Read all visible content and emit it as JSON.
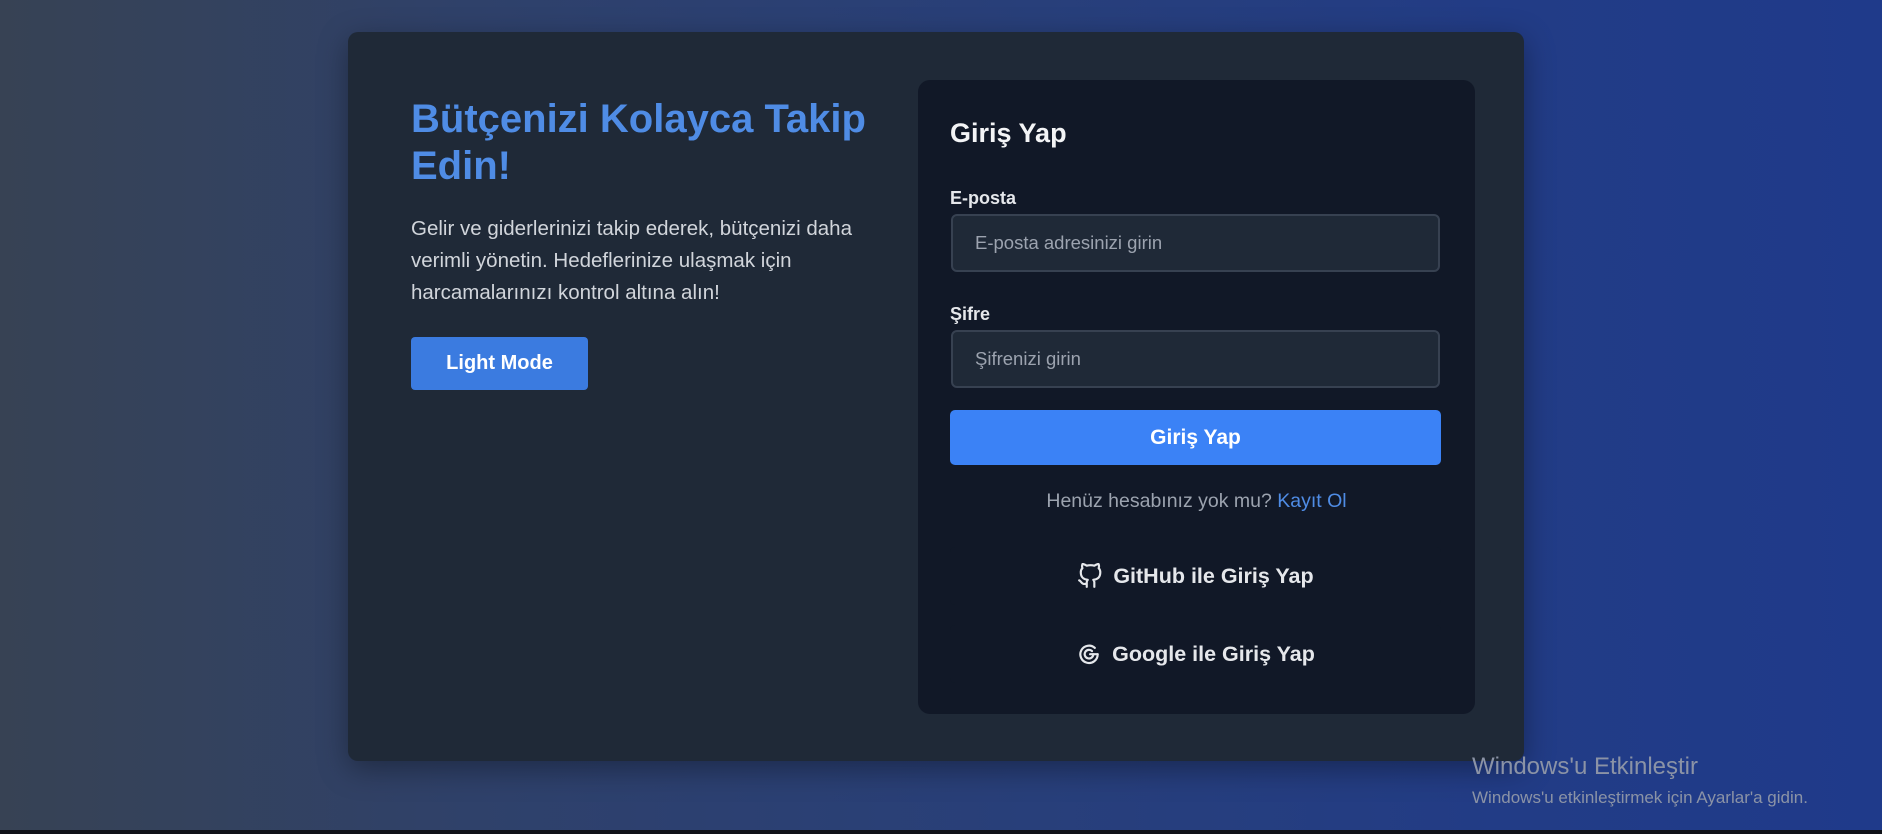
{
  "hero": {
    "headline": "Bütçenizi Kolayca Takip Edin!",
    "description": "Gelir ve giderlerinizi takip ederek, bütçenizi daha verimli yönetin. Hedeflerinize ulaşmak için harcamalarınızı kontrol altına alın!",
    "theme_button_label": "Light Mode"
  },
  "login": {
    "title": "Giriş Yap",
    "email_label": "E-posta",
    "email_placeholder": "E-posta adresinizi girin",
    "email_value": "",
    "password_label": "Şifre",
    "password_placeholder": "Şifrenizi girin",
    "password_value": "",
    "submit_label": "Giriş Yap",
    "register_prompt": "Henüz hesabınız yok mu?",
    "register_link": "Kayıt Ol",
    "github_label": "GitHub ile Giriş Yap",
    "github_icon": "github-icon",
    "google_label": "Google ile Giriş Yap",
    "google_icon": "google-icon"
  },
  "watermark": {
    "title": "Windows'u Etkinleştir",
    "subtitle": "Windows'u etkinleştirmek için Ayarlar'a gidin."
  },
  "colors": {
    "accent": "#3b82f6",
    "headline": "#4f8ce5",
    "card_bg": "#1f2937",
    "panel_bg": "#111827"
  }
}
